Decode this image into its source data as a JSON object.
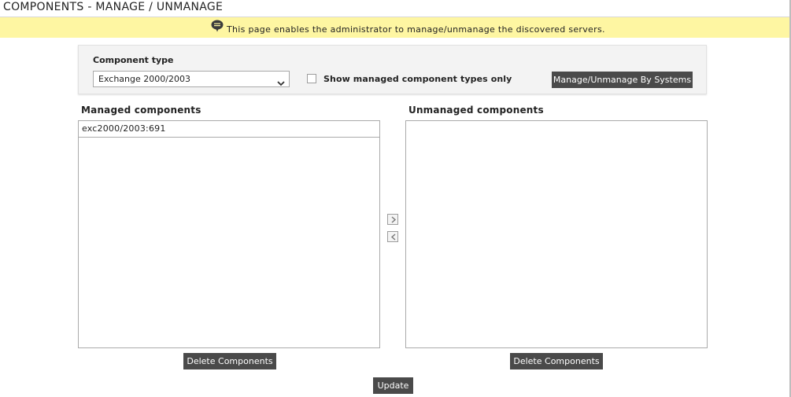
{
  "header": {
    "title": "COMPONENTS - MANAGE / UNMANAGE"
  },
  "info": {
    "icon": "comment-icon",
    "text": "This page enables the administrator to manage/unmanage the discovered servers."
  },
  "filter": {
    "component_type_label": "Component type",
    "selected_type": "Exchange 2000/2003",
    "show_managed_label": "Show managed component types only",
    "show_managed_checked": false,
    "systems_button": "Manage/Unmanage By Systems"
  },
  "managed": {
    "title": "Managed components",
    "items": [
      "exc2000/2003:691"
    ],
    "delete_button": "Delete Components"
  },
  "unmanaged": {
    "title": "Unmanaged components",
    "items": [],
    "delete_button": "Delete Components"
  },
  "transfer": {
    "move_right_icon": "chevron-right-icon",
    "move_left_icon": "chevron-left-icon"
  },
  "footer": {
    "update_button": "Update"
  },
  "colors": {
    "info_bar": "#fef6a2",
    "button": "#4a4a4a",
    "panel": "#f3f3f3"
  }
}
